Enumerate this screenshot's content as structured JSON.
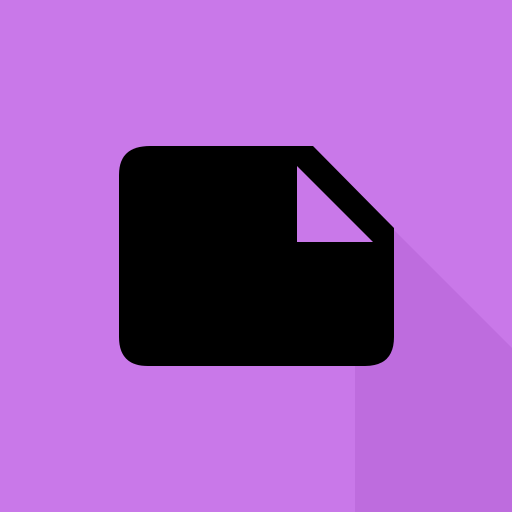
{
  "colors": {
    "background": "#c978e9",
    "icon": "#000000",
    "fold": "#c978e9",
    "shadow": "#b462d6"
  },
  "icon": {
    "name": "document-icon",
    "style": "flat-long-shadow"
  }
}
